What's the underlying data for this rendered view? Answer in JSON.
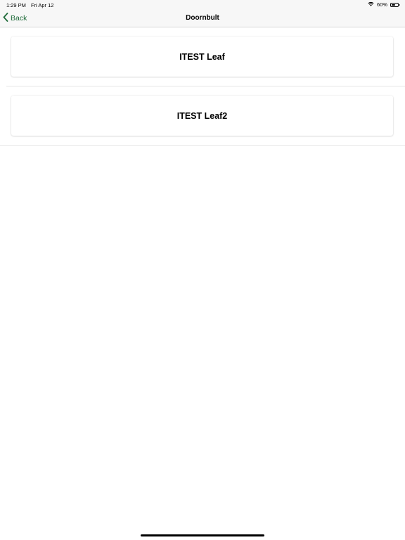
{
  "status_bar": {
    "time": "1:29 PM",
    "date": "Fri Apr 12",
    "battery_percent": "60%",
    "battery_level": 0.6
  },
  "nav": {
    "back_label": "Back",
    "title": "Doornbult"
  },
  "items": [
    {
      "label": "ITEST Leaf"
    },
    {
      "label": "ITEST Leaf2"
    }
  ],
  "colors": {
    "accent": "#1f6b3a",
    "bar_background": "#f7f7f7"
  }
}
